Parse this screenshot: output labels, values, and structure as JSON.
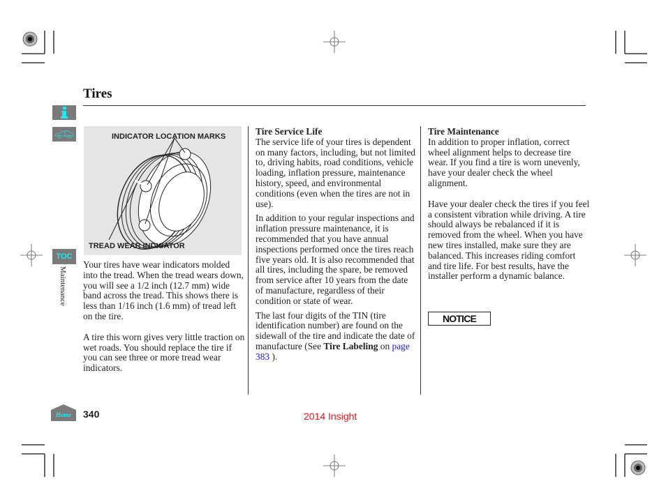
{
  "page": {
    "title": "Tires",
    "section": "Maintenance",
    "page_number": "340",
    "footer_title": "2014 Insight"
  },
  "nav": {
    "info_icon": "info-icon",
    "car_icon": "car-icon",
    "toc_label": "TOC",
    "home_label": "Home"
  },
  "figure": {
    "label_top": "INDICATOR LOCATION MARKS",
    "label_bottom": "TREAD WEAR INDICATOR"
  },
  "col1": {
    "p1": "Your tires have wear indicators molded into the tread. When the tread wears down, you will see a 1/2 inch (12.7 mm) wide band across the tread. This shows there is less than 1/16 inch (1.6 mm) of tread left on the tire.",
    "p2": "A tire this worn gives very little traction on wet roads. You should replace the tire if you can see three or more tread wear indicators."
  },
  "col2": {
    "heading": "Tire Service Life",
    "p1": "The service life of your tires is dependent on many factors, including, but not limited to, driving habits, road conditions, vehicle loading, inflation pressure, maintenance history, speed, and environmental conditions (even when the tires are not in use).",
    "p2": "In addition to your regular inspections and inflation pressure maintenance, it is recommended that you have annual inspections performed once the tires reach five years old. It is also recommended that all tires, including the spare, be removed from service after 10 years from the date of manufacture, regardless of their condition or state of wear.",
    "p3_pre": "The last four digits of the TIN (tire identification number) are found on the sidewall of the tire and indicate the date of manufacture (See ",
    "p3_bold": "Tire Labeling",
    "p3_on": " on ",
    "p3_link": "page 383",
    "p3_post": " )."
  },
  "col3": {
    "heading": "Tire Maintenance",
    "p1": "In addition to proper inflation, correct wheel alignment helps to decrease tire wear. If you find a tire is worn unevenly, have your dealer check the wheel alignment.",
    "p2": "Have your dealer check the tires if you feel a consistent vibration while driving. A tire should always be rebalanced if it is removed from the wheel. When you have new tires installed, make sure they are balanced. This increases riding comfort and tire life. For best results, have the installer perform a dynamic balance.",
    "notice_label": "NOTICE"
  },
  "colors": {
    "nav_bg": "#7a7a7a",
    "nav_fg": "#22e6f0",
    "link": "#1a1adf",
    "footer": "#ee1111"
  }
}
